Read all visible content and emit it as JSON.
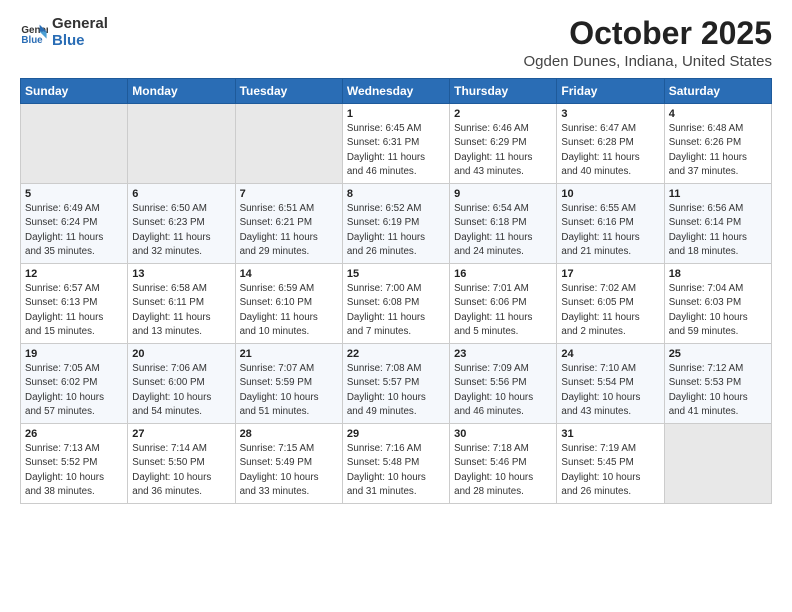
{
  "logo": {
    "line1": "General",
    "line2": "Blue"
  },
  "title": "October 2025",
  "subtitle": "Ogden Dunes, Indiana, United States",
  "headers": [
    "Sunday",
    "Monday",
    "Tuesday",
    "Wednesday",
    "Thursday",
    "Friday",
    "Saturday"
  ],
  "weeks": [
    [
      {
        "day": "",
        "info": ""
      },
      {
        "day": "",
        "info": ""
      },
      {
        "day": "",
        "info": ""
      },
      {
        "day": "1",
        "info": "Sunrise: 6:45 AM\nSunset: 6:31 PM\nDaylight: 11 hours\nand 46 minutes."
      },
      {
        "day": "2",
        "info": "Sunrise: 6:46 AM\nSunset: 6:29 PM\nDaylight: 11 hours\nand 43 minutes."
      },
      {
        "day": "3",
        "info": "Sunrise: 6:47 AM\nSunset: 6:28 PM\nDaylight: 11 hours\nand 40 minutes."
      },
      {
        "day": "4",
        "info": "Sunrise: 6:48 AM\nSunset: 6:26 PM\nDaylight: 11 hours\nand 37 minutes."
      }
    ],
    [
      {
        "day": "5",
        "info": "Sunrise: 6:49 AM\nSunset: 6:24 PM\nDaylight: 11 hours\nand 35 minutes."
      },
      {
        "day": "6",
        "info": "Sunrise: 6:50 AM\nSunset: 6:23 PM\nDaylight: 11 hours\nand 32 minutes."
      },
      {
        "day": "7",
        "info": "Sunrise: 6:51 AM\nSunset: 6:21 PM\nDaylight: 11 hours\nand 29 minutes."
      },
      {
        "day": "8",
        "info": "Sunrise: 6:52 AM\nSunset: 6:19 PM\nDaylight: 11 hours\nand 26 minutes."
      },
      {
        "day": "9",
        "info": "Sunrise: 6:54 AM\nSunset: 6:18 PM\nDaylight: 11 hours\nand 24 minutes."
      },
      {
        "day": "10",
        "info": "Sunrise: 6:55 AM\nSunset: 6:16 PM\nDaylight: 11 hours\nand 21 minutes."
      },
      {
        "day": "11",
        "info": "Sunrise: 6:56 AM\nSunset: 6:14 PM\nDaylight: 11 hours\nand 18 minutes."
      }
    ],
    [
      {
        "day": "12",
        "info": "Sunrise: 6:57 AM\nSunset: 6:13 PM\nDaylight: 11 hours\nand 15 minutes."
      },
      {
        "day": "13",
        "info": "Sunrise: 6:58 AM\nSunset: 6:11 PM\nDaylight: 11 hours\nand 13 minutes."
      },
      {
        "day": "14",
        "info": "Sunrise: 6:59 AM\nSunset: 6:10 PM\nDaylight: 11 hours\nand 10 minutes."
      },
      {
        "day": "15",
        "info": "Sunrise: 7:00 AM\nSunset: 6:08 PM\nDaylight: 11 hours\nand 7 minutes."
      },
      {
        "day": "16",
        "info": "Sunrise: 7:01 AM\nSunset: 6:06 PM\nDaylight: 11 hours\nand 5 minutes."
      },
      {
        "day": "17",
        "info": "Sunrise: 7:02 AM\nSunset: 6:05 PM\nDaylight: 11 hours\nand 2 minutes."
      },
      {
        "day": "18",
        "info": "Sunrise: 7:04 AM\nSunset: 6:03 PM\nDaylight: 10 hours\nand 59 minutes."
      }
    ],
    [
      {
        "day": "19",
        "info": "Sunrise: 7:05 AM\nSunset: 6:02 PM\nDaylight: 10 hours\nand 57 minutes."
      },
      {
        "day": "20",
        "info": "Sunrise: 7:06 AM\nSunset: 6:00 PM\nDaylight: 10 hours\nand 54 minutes."
      },
      {
        "day": "21",
        "info": "Sunrise: 7:07 AM\nSunset: 5:59 PM\nDaylight: 10 hours\nand 51 minutes."
      },
      {
        "day": "22",
        "info": "Sunrise: 7:08 AM\nSunset: 5:57 PM\nDaylight: 10 hours\nand 49 minutes."
      },
      {
        "day": "23",
        "info": "Sunrise: 7:09 AM\nSunset: 5:56 PM\nDaylight: 10 hours\nand 46 minutes."
      },
      {
        "day": "24",
        "info": "Sunrise: 7:10 AM\nSunset: 5:54 PM\nDaylight: 10 hours\nand 43 minutes."
      },
      {
        "day": "25",
        "info": "Sunrise: 7:12 AM\nSunset: 5:53 PM\nDaylight: 10 hours\nand 41 minutes."
      }
    ],
    [
      {
        "day": "26",
        "info": "Sunrise: 7:13 AM\nSunset: 5:52 PM\nDaylight: 10 hours\nand 38 minutes."
      },
      {
        "day": "27",
        "info": "Sunrise: 7:14 AM\nSunset: 5:50 PM\nDaylight: 10 hours\nand 36 minutes."
      },
      {
        "day": "28",
        "info": "Sunrise: 7:15 AM\nSunset: 5:49 PM\nDaylight: 10 hours\nand 33 minutes."
      },
      {
        "day": "29",
        "info": "Sunrise: 7:16 AM\nSunset: 5:48 PM\nDaylight: 10 hours\nand 31 minutes."
      },
      {
        "day": "30",
        "info": "Sunrise: 7:18 AM\nSunset: 5:46 PM\nDaylight: 10 hours\nand 28 minutes."
      },
      {
        "day": "31",
        "info": "Sunrise: 7:19 AM\nSunset: 5:45 PM\nDaylight: 10 hours\nand 26 minutes."
      },
      {
        "day": "",
        "info": ""
      }
    ]
  ]
}
